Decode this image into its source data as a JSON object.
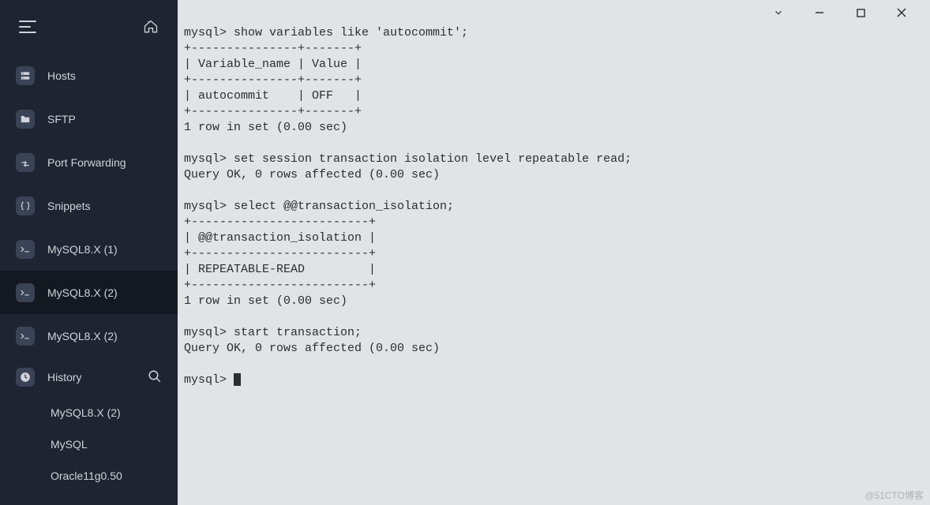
{
  "sidebar": {
    "nav": [
      {
        "label": "Hosts",
        "icon": "hosts-icon"
      },
      {
        "label": "SFTP",
        "icon": "folder-icon"
      },
      {
        "label": "Port Forwarding",
        "icon": "forward-icon"
      },
      {
        "label": "Snippets",
        "icon": "braces-icon"
      }
    ],
    "sessions": [
      {
        "label": "MySQL8.X (1)",
        "active": false
      },
      {
        "label": "MySQL8.X (2)",
        "active": true
      },
      {
        "label": "MySQL8.X (2)",
        "active": false
      }
    ],
    "history_label": "History",
    "history": [
      {
        "label": "MySQL8.X (2)"
      },
      {
        "label": "MySQL"
      },
      {
        "label": "Oracle11g0.50"
      }
    ]
  },
  "terminal": {
    "lines": [
      "mysql> show variables like 'autocommit';",
      "+---------------+-------+",
      "| Variable_name | Value |",
      "+---------------+-------+",
      "| autocommit    | OFF   |",
      "+---------------+-------+",
      "1 row in set (0.00 sec)",
      "",
      "mysql> set session transaction isolation level repeatable read;",
      "Query OK, 0 rows affected (0.00 sec)",
      "",
      "mysql> select @@transaction_isolation;",
      "+-------------------------+",
      "| @@transaction_isolation |",
      "+-------------------------+",
      "| REPEATABLE-READ         |",
      "+-------------------------+",
      "1 row in set (0.00 sec)",
      "",
      "mysql> start transaction;",
      "Query OK, 0 rows affected (0.00 sec)",
      "",
      "mysql> "
    ]
  },
  "watermark": "@51CTO博客"
}
